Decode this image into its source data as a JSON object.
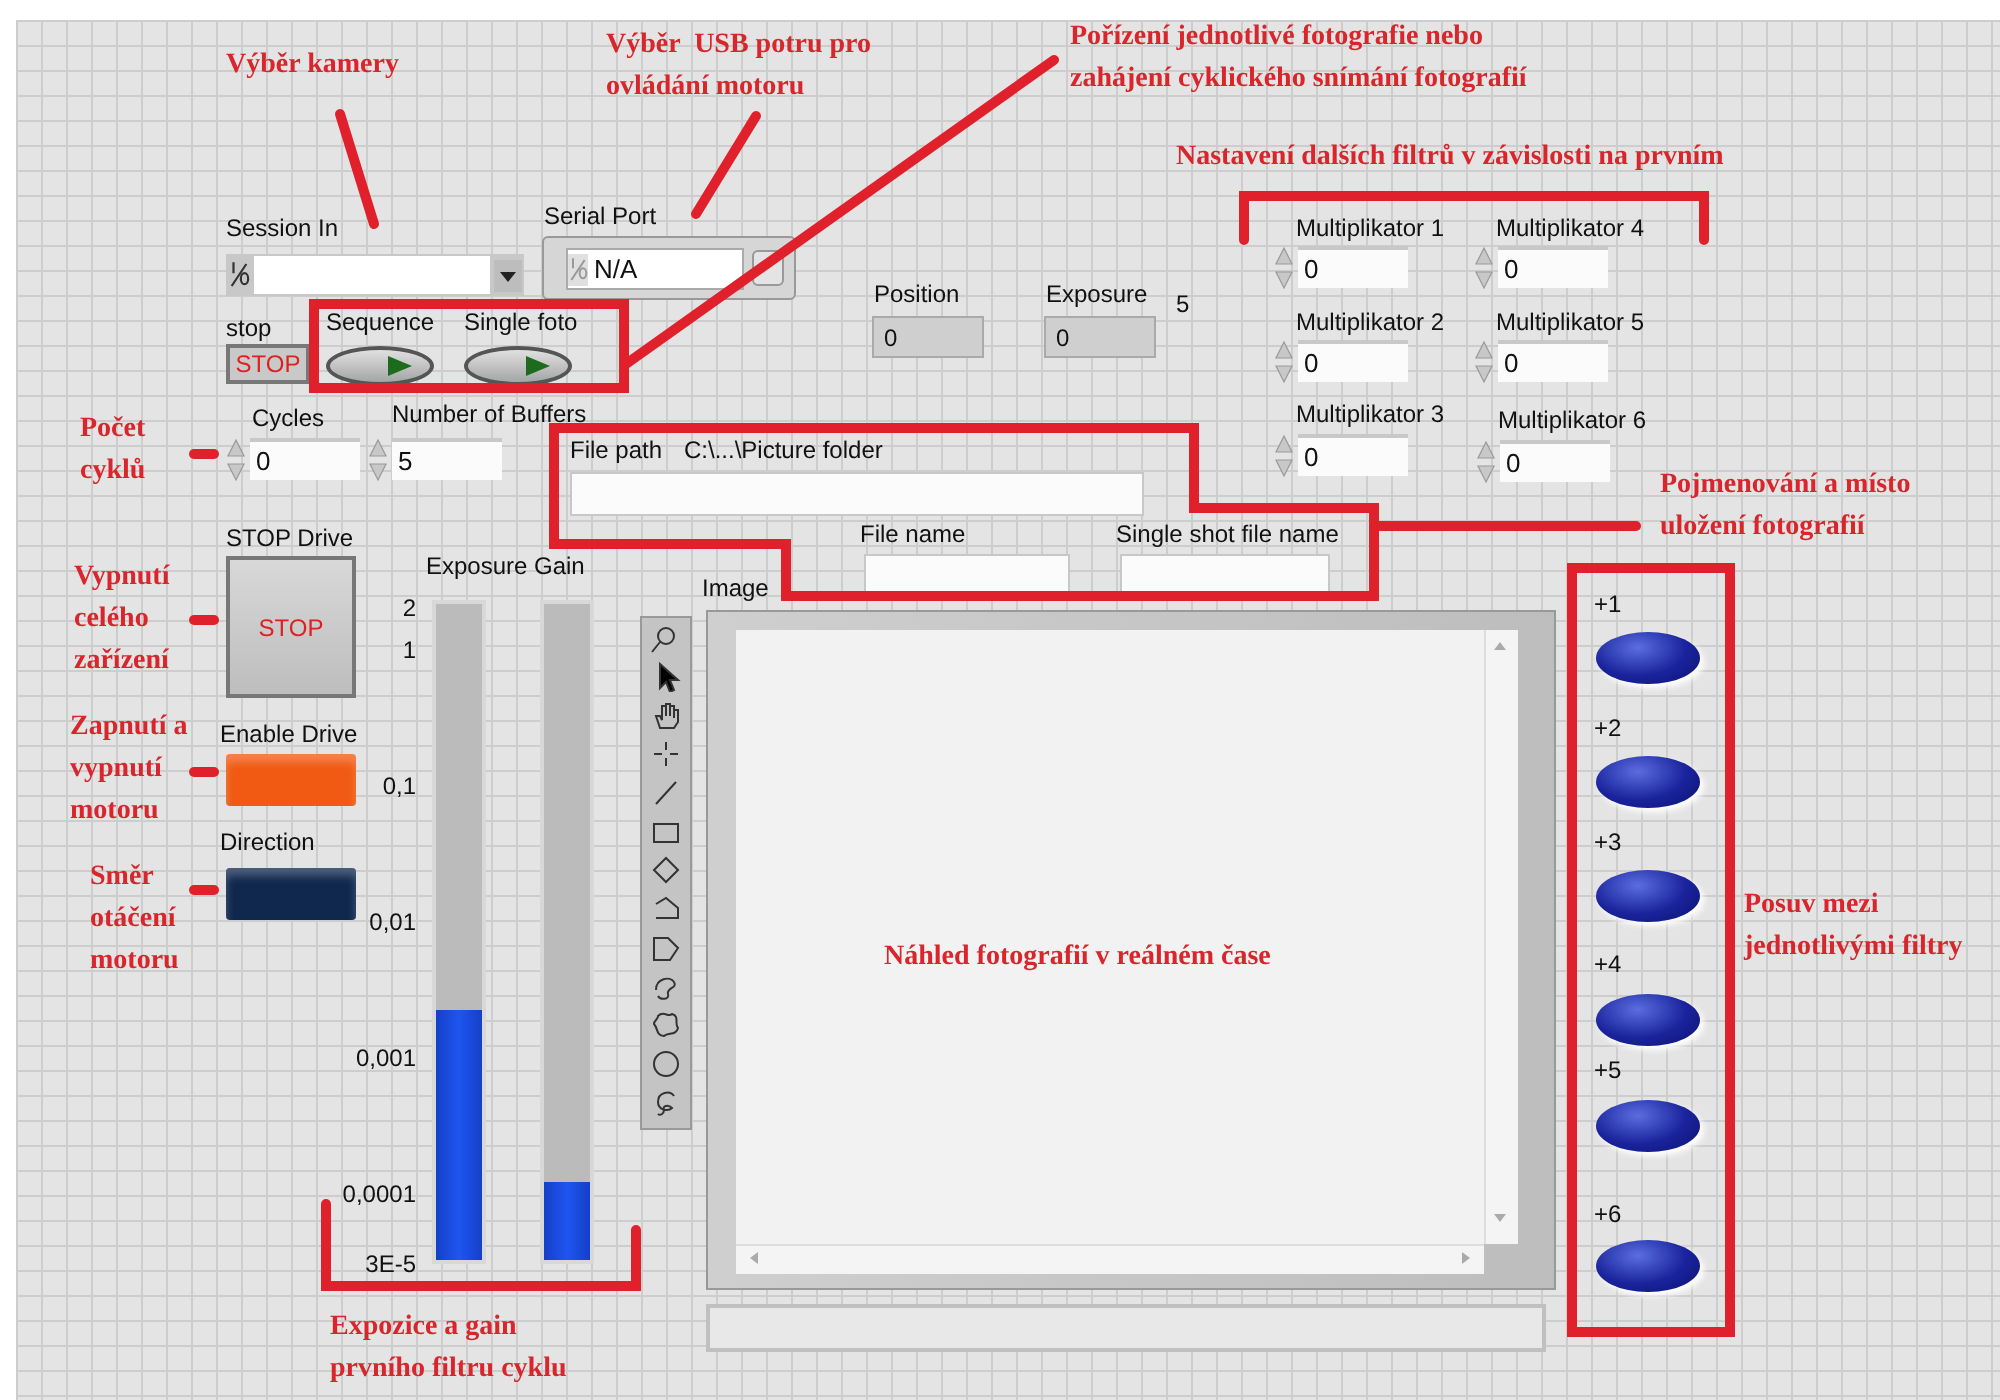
{
  "annotations": [
    {
      "text": "Výběr kamery"
    },
    {
      "text": "Výběr  USB potru pro\novládání motoru"
    },
    {
      "text": "Pořízení jednotlivé fotografie nebo\nzahájení cyklického snímání fotografií"
    },
    {
      "text": "Nastavení dalších filtrů v závislosti na prvním"
    },
    {
      "text": "Počet\ncyklů"
    },
    {
      "text": "Pojmenování a místo\nuložení fotografií"
    },
    {
      "text": "Vypnutí\ncelého\nzařízení"
    },
    {
      "text": "Zapnutí a\nvypnutí\nmotoru"
    },
    {
      "text": "Směr\notáčení\nmotoru"
    },
    {
      "text": "Náhled fotografií v reálném čase"
    },
    {
      "text": "Posuv mezi\njednotlivými filtry"
    },
    {
      "text": "Expozice a gain\nprvního filtru cyklu"
    }
  ],
  "session_in": {
    "label": "Session In"
  },
  "serial_port": {
    "label": "Serial Port",
    "value": "N/A"
  },
  "indicators": [
    {
      "label": "Position",
      "value": "0"
    },
    {
      "label": "Exposure",
      "value": "0"
    }
  ],
  "exposure_note": "5",
  "stop": {
    "label": "stop",
    "button": "STOP"
  },
  "toggles": [
    {
      "label": "Sequence"
    },
    {
      "label": "Single foto"
    }
  ],
  "numerics": [
    {
      "label": "Cycles",
      "value": "0"
    },
    {
      "label": "Number of Buffers",
      "value": "5"
    }
  ],
  "file_path": {
    "label": "File path",
    "default": "C:\\...\\Picture folder"
  },
  "file_name": {
    "label": "File name"
  },
  "single_shot": {
    "label": "Single shot file name"
  },
  "stop_drive": {
    "label": "STOP Drive",
    "button": "STOP"
  },
  "leds": [
    {
      "label": "Enable Drive",
      "color": "#f05a12"
    },
    {
      "label": "Direction",
      "color": "#10284e"
    }
  ],
  "slides": [
    {
      "label": "Exposure",
      "level": 0.38
    },
    {
      "label": "Gain",
      "level": 0.12
    }
  ],
  "scale": [
    "2",
    "1",
    "0,1",
    "0,01",
    "0,001",
    "0,0001",
    "3E-5"
  ],
  "image": {
    "label": "Image"
  },
  "multiplicators": [
    {
      "label": "Multiplikator 1",
      "value": "0"
    },
    {
      "label": "Multiplikator 2",
      "value": "0"
    },
    {
      "label": "Multiplikator 3",
      "value": "0"
    },
    {
      "label": "Multiplikator 4",
      "value": "0"
    },
    {
      "label": "Multiplikator 5",
      "value": "0"
    },
    {
      "label": "Multiplikator 6",
      "value": "0"
    }
  ],
  "filter_buttons": [
    {
      "label": "+1"
    },
    {
      "label": "+2"
    },
    {
      "label": "+3"
    },
    {
      "label": "+4"
    },
    {
      "label": "+5"
    },
    {
      "label": "+6"
    }
  ]
}
